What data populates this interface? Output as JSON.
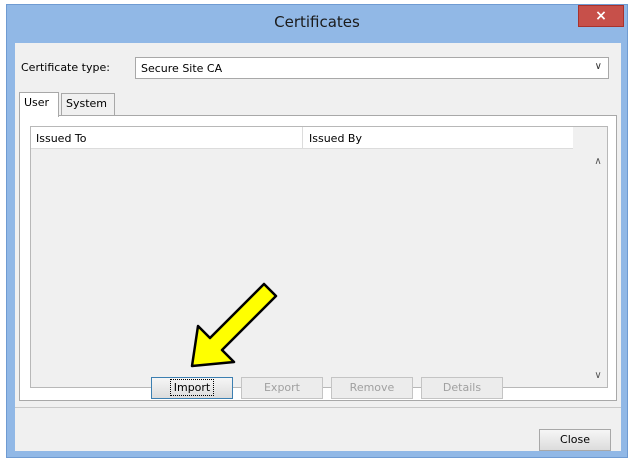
{
  "window": {
    "title": "Certificates",
    "close_glyph": "×"
  },
  "certificate_type": {
    "label": "Certificate type:",
    "selected": "Secure Site CA"
  },
  "tabs": [
    {
      "label": "User",
      "active": true
    },
    {
      "label": "System",
      "active": false
    }
  ],
  "table": {
    "columns": [
      "Issued To",
      "Issued By"
    ],
    "rows": []
  },
  "buttons": {
    "import": "Import",
    "export": "Export",
    "remove": "Remove",
    "details": "Details",
    "close": "Close"
  },
  "colors": {
    "window_frame": "#91b8e6",
    "close_button": "#c7504a",
    "annotation_arrow": "#ffff00"
  },
  "icons": {
    "dropdown": "chevron-down-icon",
    "scroll_up": "chevron-up-icon",
    "scroll_down": "chevron-down-icon",
    "annotation": "pointer-arrow-icon"
  }
}
